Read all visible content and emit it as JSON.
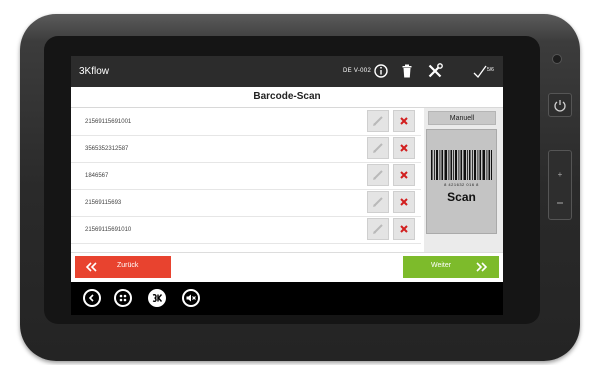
{
  "app": {
    "title": "3Kflow",
    "device_label": "DE V-002",
    "icons": [
      "info-icon",
      "trash-icon",
      "tools-icon",
      "check-icon"
    ],
    "check_count": "5/6"
  },
  "screen": {
    "title": "Barcode-Scan"
  },
  "scanned_items": [
    {
      "code": "21569115691001"
    },
    {
      "code": "3565352312587"
    },
    {
      "code": "1846567"
    },
    {
      "code": "21569115693"
    },
    {
      "code": "21569115691010"
    }
  ],
  "side_panel": {
    "manual_label": "Manuell",
    "scan_label": "Scan",
    "barcode_digits": "8 421632 016 8"
  },
  "footer": {
    "back_label": "Zurück",
    "next_label": "Weiter"
  },
  "nav": {
    "icons": [
      "back-icon",
      "apps-icon",
      "3k-logo-icon",
      "mute-icon"
    ]
  },
  "colors": {
    "back": "#e8432f",
    "next": "#7dbb2b",
    "delete_x": "#d21f1f"
  }
}
